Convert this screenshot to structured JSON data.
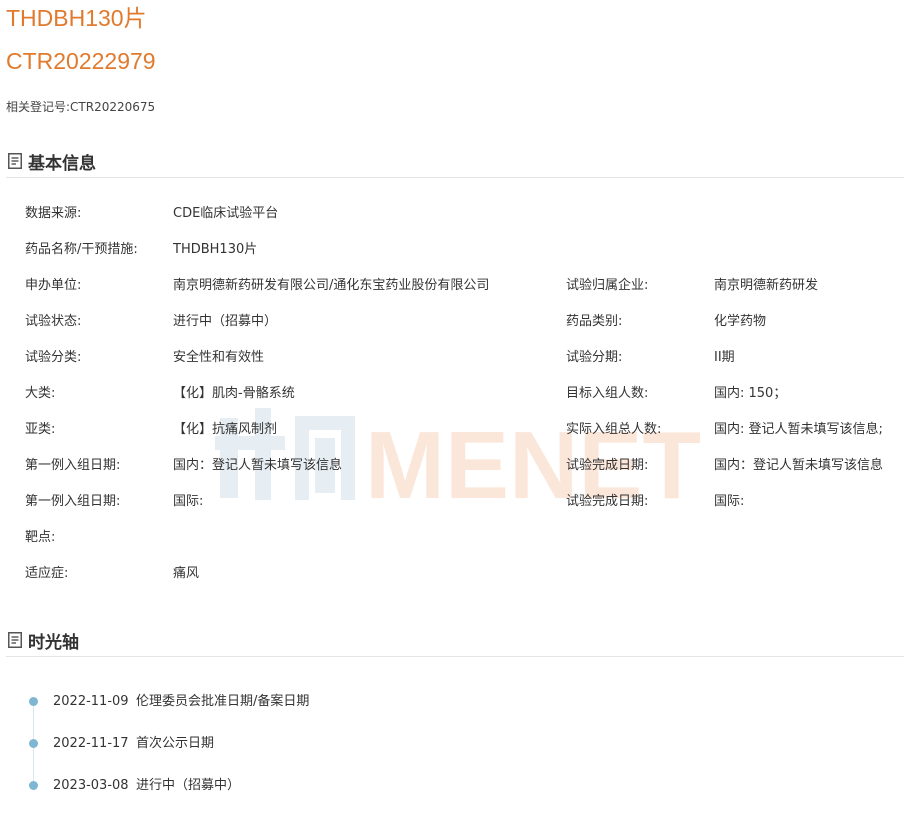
{
  "header": {
    "title_line1": "THDBH130片",
    "title_line2": "CTR20222979",
    "related_label": "相关登记号:",
    "related_value": "CTR20220675"
  },
  "basic_info": {
    "heading": "基本信息",
    "rows": [
      [
        {
          "label": "数据来源:",
          "value": "CDE临床试验平台"
        }
      ],
      [
        {
          "label": "药品名称/干预措施:",
          "value": "THDBH130片"
        }
      ],
      [
        {
          "label": "申办单位:",
          "value": "南京明德新药研发有限公司/通化东宝药业股份有限公司"
        },
        {
          "label": "试验归属企业:",
          "value": "南京明德新药研发"
        }
      ],
      [
        {
          "label": "试验状态:",
          "value": "进行中（招募中）"
        },
        {
          "label": "药品类别:",
          "value": "化学药物"
        }
      ],
      [
        {
          "label": "试验分类:",
          "value": "安全性和有效性"
        },
        {
          "label": "试验分期:",
          "value": "II期"
        }
      ],
      [
        {
          "label": "大类:",
          "value": "【化】肌肉-骨骼系统"
        },
        {
          "label": "目标入组人数:",
          "value": "国内: 150；"
        }
      ],
      [
        {
          "label": "亚类:",
          "value": "【化】抗痛风制剂"
        },
        {
          "label": "实际入组总人数:",
          "value": "国内: 登记人暂未填写该信息;"
        }
      ],
      [
        {
          "label": "第一例入组日期:",
          "value": "国内：登记人暂未填写该信息"
        },
        {
          "label": "试验完成日期:",
          "value": "国内：登记人暂未填写该信息"
        }
      ],
      [
        {
          "label": "第一例入组日期:",
          "value": "国际:"
        },
        {
          "label": "试验完成日期:",
          "value": "国际:"
        }
      ],
      [
        {
          "label": "靶点:",
          "value": ""
        }
      ],
      [
        {
          "label": "适应症:",
          "value": "痛风"
        }
      ]
    ]
  },
  "watermark": {
    "latin": "MENET"
  },
  "timeline": {
    "heading": "时光轴",
    "items": [
      {
        "date": "2022-11-09",
        "text": "伦理委员会批准日期/备案日期"
      },
      {
        "date": "2022-11-17",
        "text": "首次公示日期"
      },
      {
        "date": "2023-03-08",
        "text": "进行中（招募中）"
      }
    ]
  },
  "colors": {
    "accent": "#e07a2d",
    "timeline_dot": "#7fb6d3"
  },
  "icons": {
    "section": "document-icon"
  }
}
